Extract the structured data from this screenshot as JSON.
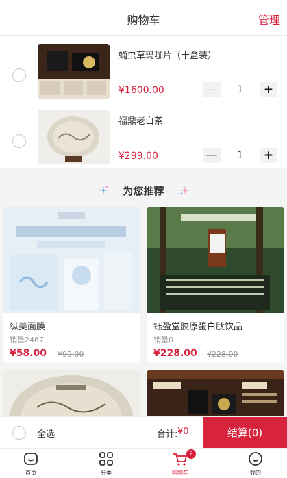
{
  "header": {
    "title": "购物车",
    "manage": "管理"
  },
  "cart": {
    "items": [
      {
        "name": "蛹虫草玛咖片（十盒装）",
        "price": "¥1600.00",
        "quantity": "1",
        "minus": "—",
        "plus": "+"
      },
      {
        "name": "福鼎老白茶",
        "price": "¥299.00",
        "quantity": "1",
        "minus": "—",
        "plus": "+"
      }
    ]
  },
  "recommend": {
    "title": "为您推荐",
    "products": [
      {
        "name": "纵美面膜",
        "sold_label": "销量",
        "sold": "2467",
        "price": "¥58.00",
        "old_price": "¥99.00"
      },
      {
        "name": "钰盈堂胶原蛋白肽饮品",
        "sold_label": "销量",
        "sold": "0",
        "price": "¥228.00",
        "old_price": "¥228.00"
      }
    ]
  },
  "checkout": {
    "select_all": "全选",
    "total_label": "合计:",
    "total_value": "¥0",
    "pay_button": "结算(0)"
  },
  "tabbar": {
    "items": [
      {
        "label": "首页",
        "icon": "home-icon"
      },
      {
        "label": "分类",
        "icon": "category-icon"
      },
      {
        "label": "购物车",
        "icon": "cart-icon",
        "badge": "2"
      },
      {
        "label": "我的",
        "icon": "profile-icon"
      }
    ]
  },
  "colors": {
    "accent": "#d81e3a",
    "pay_button": "#d8233c",
    "background": "#f4f4f4"
  }
}
